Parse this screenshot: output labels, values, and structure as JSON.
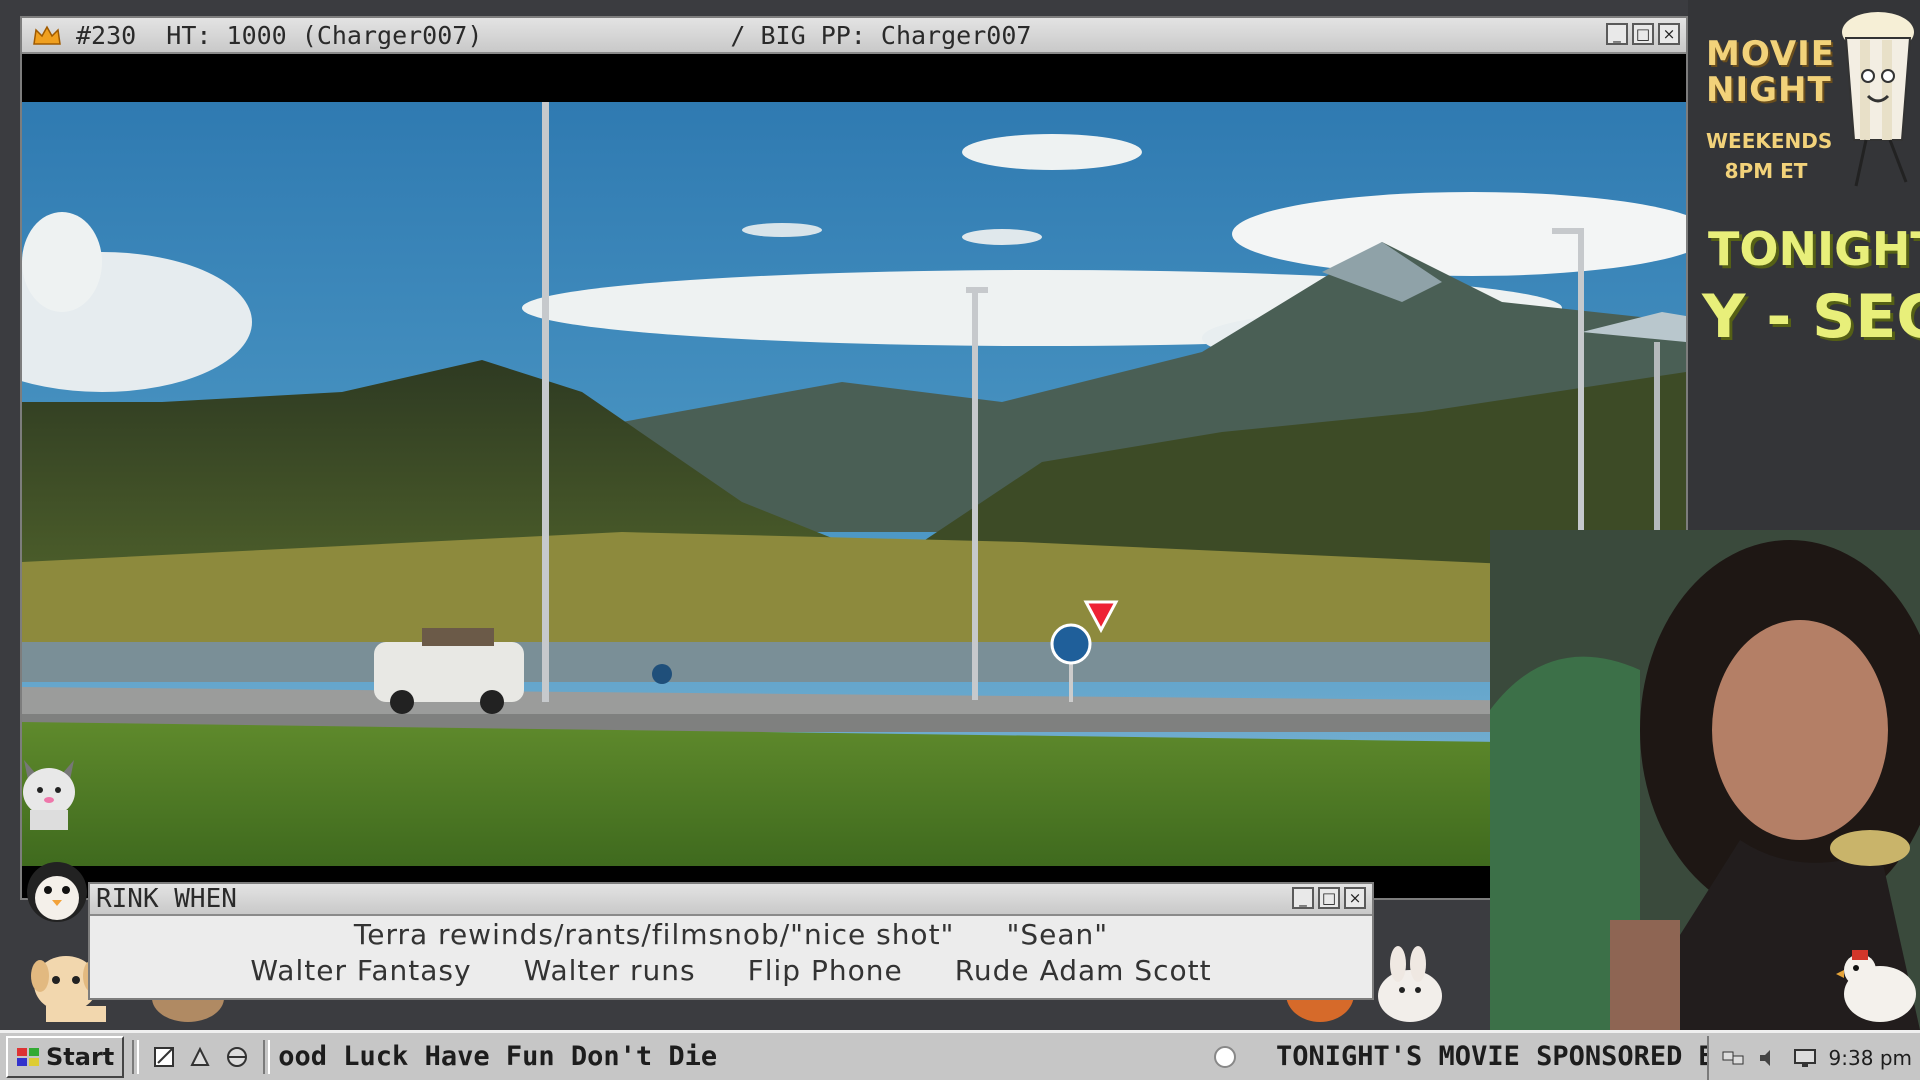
{
  "video_window": {
    "title_left": "#230  HT: 1000 (Charger007)",
    "title_right": "/ BIG PP: Charger007",
    "minimize_label": "_",
    "maximize_label": "□",
    "close_label": "×"
  },
  "side_panel": {
    "movie_night": "MOVIE\nNIGHT",
    "schedule_line1": "WEEKENDS",
    "schedule_line2": "8PM ET",
    "tonight_label": "TONIGHT:",
    "tonight_title_fragment": "Y - SEC"
  },
  "drink_window": {
    "title": "RINK WHEN",
    "row1": [
      "Terra rewinds/rants/filmsnob/\"nice shot\"",
      "\"Sean\""
    ],
    "row2": [
      "Walter Fantasy",
      "Walter runs",
      "Flip Phone",
      "Rude Adam Scott"
    ]
  },
  "taskbar": {
    "start_label": "Start",
    "ticker_text": "ood Luck Have Fun Don't Die",
    "sponsor_text": "TONIGHT'S MOVIE SPONSORED BY",
    "clock": "9:38 pm"
  },
  "colors": {
    "accent_yellow": "#e8ef7a",
    "movie_night_gold": "#f2d27a",
    "panel_bg": "#343538",
    "chrome_gray": "#c6c6c6"
  }
}
